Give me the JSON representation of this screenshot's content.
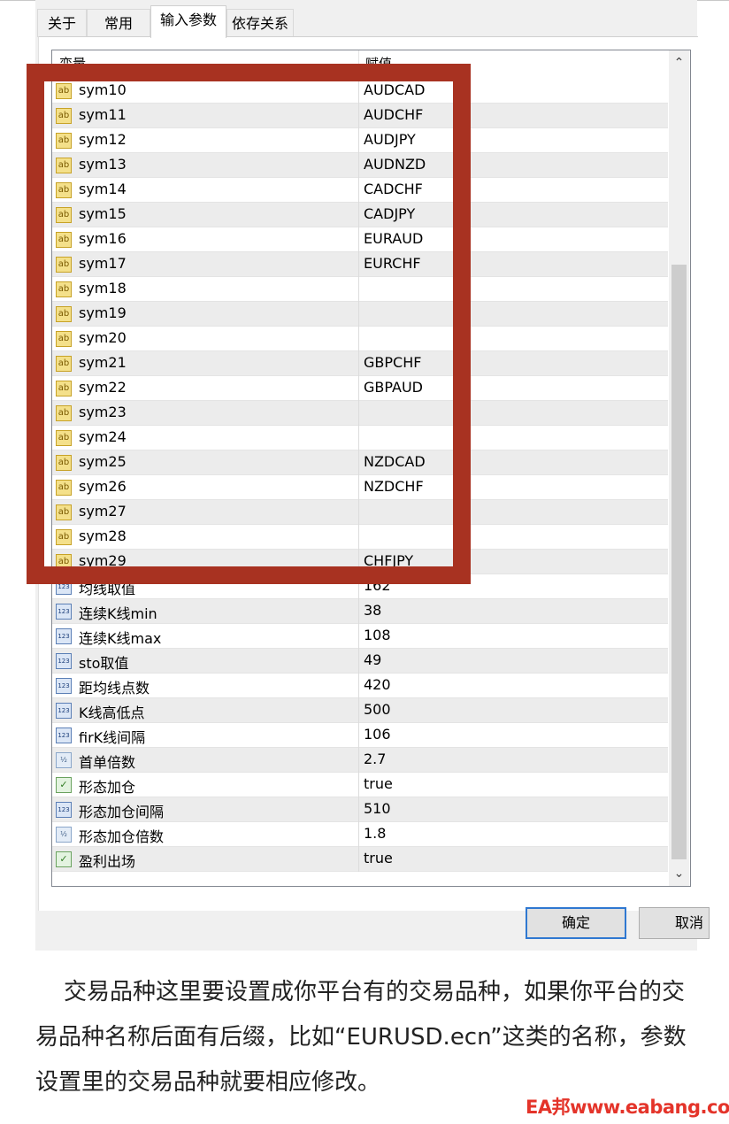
{
  "tabs": [
    "关于",
    "常用",
    "输入参数",
    "依存关系"
  ],
  "active_tab": "输入参数",
  "table": {
    "headers": [
      "变量",
      "赋值"
    ],
    "rows": [
      {
        "icon": "string-icon",
        "name": "sym10",
        "value": "AUDCAD"
      },
      {
        "icon": "string-icon",
        "name": "sym11",
        "value": "AUDCHF"
      },
      {
        "icon": "string-icon",
        "name": "sym12",
        "value": "AUDJPY"
      },
      {
        "icon": "string-icon",
        "name": "sym13",
        "value": "AUDNZD"
      },
      {
        "icon": "string-icon",
        "name": "sym14",
        "value": "CADCHF"
      },
      {
        "icon": "string-icon",
        "name": "sym15",
        "value": "CADJPY"
      },
      {
        "icon": "string-icon",
        "name": "sym16",
        "value": "EURAUD"
      },
      {
        "icon": "string-icon",
        "name": "sym17",
        "value": "EURCHF"
      },
      {
        "icon": "string-icon",
        "name": "sym18",
        "value": ""
      },
      {
        "icon": "string-icon",
        "name": "sym19",
        "value": ""
      },
      {
        "icon": "string-icon",
        "name": "sym20",
        "value": ""
      },
      {
        "icon": "string-icon",
        "name": "sym21",
        "value": "GBPCHF"
      },
      {
        "icon": "string-icon",
        "name": "sym22",
        "value": "GBPAUD"
      },
      {
        "icon": "string-icon",
        "name": "sym23",
        "value": ""
      },
      {
        "icon": "string-icon",
        "name": "sym24",
        "value": ""
      },
      {
        "icon": "string-icon",
        "name": "sym25",
        "value": "NZDCAD"
      },
      {
        "icon": "string-icon",
        "name": "sym26",
        "value": "NZDCHF"
      },
      {
        "icon": "string-icon",
        "name": "sym27",
        "value": ""
      },
      {
        "icon": "string-icon",
        "name": "sym28",
        "value": ""
      },
      {
        "icon": "string-icon",
        "name": "sym29",
        "value": "CHFJPY"
      },
      {
        "icon": "integer-icon",
        "name": "均线取值",
        "value": "162"
      },
      {
        "icon": "integer-icon",
        "name": "连续K线min",
        "value": "38"
      },
      {
        "icon": "integer-icon",
        "name": "连续K线max",
        "value": "108"
      },
      {
        "icon": "integer-icon",
        "name": "sto取值",
        "value": "49"
      },
      {
        "icon": "integer-icon",
        "name": "距均线点数",
        "value": "420"
      },
      {
        "icon": "integer-icon",
        "name": "K线高低点",
        "value": "500"
      },
      {
        "icon": "integer-icon",
        "name": "firK线间隔",
        "value": "106"
      },
      {
        "icon": "double-icon",
        "name": "首单倍数",
        "value": "2.7"
      },
      {
        "icon": "bool-icon",
        "name": "形态加仓",
        "value": "true"
      },
      {
        "icon": "integer-icon",
        "name": "形态加仓间隔",
        "value": "510"
      },
      {
        "icon": "double-icon",
        "name": "形态加仓倍数",
        "value": "1.8"
      },
      {
        "icon": "bool-icon",
        "name": "盈利出场",
        "value": "true"
      }
    ]
  },
  "buttons": {
    "ok": "确定",
    "cancel": "取消"
  },
  "icon_glyphs": {
    "string-icon": "ab",
    "integer-icon": "123",
    "double-icon": "½",
    "bool-icon": "✓"
  },
  "colors": {
    "highlight_border": "#a83221",
    "ok_border": "#2f78d1",
    "watermark": "#e4342a"
  },
  "paragraph": "交易品种这里要设置成你平台有的交易品种，如果你平台的交易品种名称后面有后缀，比如“EURUSD.ecn”这类的名称，参数设置里的交易品种就要相应修改。",
  "watermark": "EA邦www.eabang.com"
}
